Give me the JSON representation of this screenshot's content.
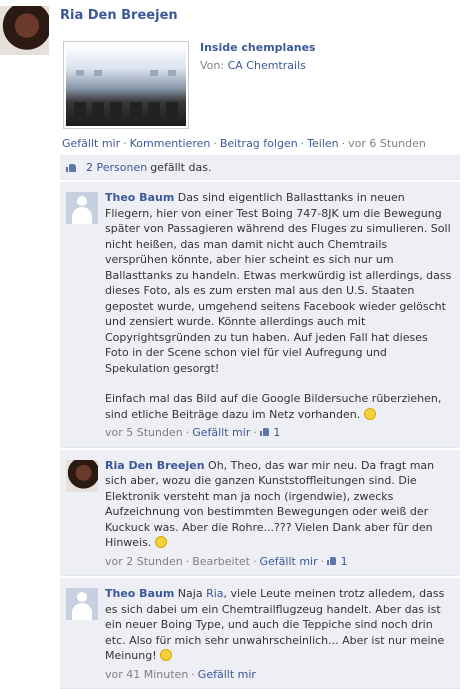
{
  "post": {
    "author": "Ria Den Breejen",
    "attachment": {
      "title": "Inside chemplanes",
      "source_prefix": "Von:",
      "source_name": "CA Chemtrails"
    },
    "actions": {
      "like": "Gefällt mir",
      "comment": "Kommentieren",
      "follow": "Beitrag folgen",
      "share": "Teilen",
      "time": "vor 6 Stunden",
      "separator": "·"
    }
  },
  "likes": {
    "count_link": "2 Personen",
    "suffix": "gefällt das."
  },
  "comments": [
    {
      "author": "Theo Baum",
      "text": "Das sind eigentlich Ballasttanks in neuen Fliegern, hier von einer Test Boing 747-8JK um die Bewegung später von Passagieren während des Fluges zu simulieren. Soll nicht heißen, das man damit nicht auch Chemtrails versprühen könnte, aber hier scheint es sich nur um Ballasttanks zu handeln. Etwas merkwürdig ist allerdings, dass dieses Foto, als es zum ersten mal aus den U.S. Staaten gepostet wurde, umgehend seitens Facebook wieder gelöscht und zensiert wurde. Könnte allerdings auch mit Copyrightsgründen zu tun haben. Auf jeden Fall hat dieses Foto in der Scene schon viel für viel Aufregung und Spekulation gesorgt!",
      "text2": "Einfach mal das Bild auf die Google Bildersuche rüberziehen, sind etliche Beiträge dazu im Netz vorhanden.",
      "time": "vor 5 Stunden",
      "like": "Gefällt mir",
      "likes": "1"
    },
    {
      "author": "Ria Den Breejen",
      "text": "Oh, Theo, das war mir neu. Da fragt man sich aber, wozu die ganzen Kunststoffleitungen sind. Die Elektronik versteht man ja noch (irgendwie), zwecks Aufzeichnung von bestimmten Bewegungen oder weiß der Kuckuck was. Aber die Rohre...??? Vielen Dank aber für den Hinweis.",
      "time": "vor 2 Stunden",
      "edited": "Bearbeitet",
      "like": "Gefällt mir",
      "likes": "1"
    },
    {
      "author": "Theo Baum",
      "text_pre": "Naja",
      "mention": "Ria",
      "text": ", viele Leute meinen trotz alledem, dass es sich dabei um ein Chemtrailflugzeug handelt. Aber das ist ein neuer Boing Type, und auch die Teppiche sind noch drin etc. Also für mich sehr unwahrscheinlich... Aber ist nur meine Meinung!",
      "time": "vor 41 Minuten",
      "like": "Gefällt mir"
    }
  ],
  "icons": {
    "like": "thumbs-up-icon",
    "smiley": "smiley-icon",
    "avatar_default": "silhouette-avatar"
  },
  "colors": {
    "link": "#3b5998",
    "comment_bg": "#edeff4",
    "meta": "#808080"
  }
}
